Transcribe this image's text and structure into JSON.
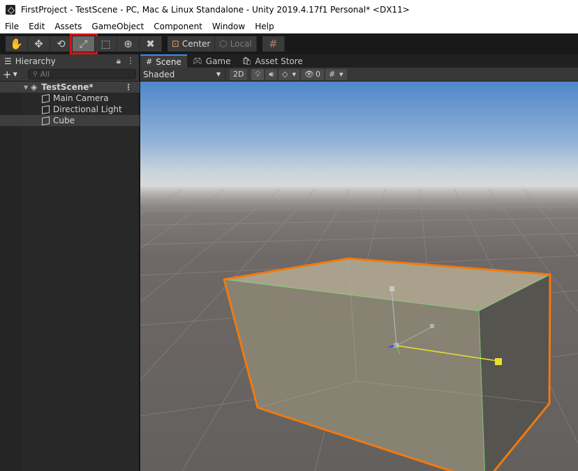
{
  "window": {
    "title": "FirstProject - TestScene - PC, Mac & Linux Standalone - Unity 2019.4.17f1 Personal* <DX11>"
  },
  "menu": [
    "File",
    "Edit",
    "Assets",
    "GameObject",
    "Component",
    "Window",
    "Help"
  ],
  "toolbar": {
    "tools": [
      {
        "name": "hand-tool",
        "icon": "hand-icon",
        "glyph": "✋"
      },
      {
        "name": "move-tool",
        "icon": "move-icon",
        "glyph": "✥"
      },
      {
        "name": "rotate-tool",
        "icon": "rotate-icon",
        "glyph": "⟲"
      },
      {
        "name": "scale-tool",
        "icon": "scale-icon",
        "glyph": "⤢"
      },
      {
        "name": "rect-tool",
        "icon": "rect-icon",
        "glyph": "⬚"
      },
      {
        "name": "transform-tool",
        "icon": "transform-icon",
        "glyph": "⊕"
      },
      {
        "name": "custom-tool",
        "icon": "tools-icon",
        "glyph": "✖"
      }
    ],
    "active_tool": "scale-tool",
    "highlighted_tool": "scale-tool",
    "pivot_mode": "Center",
    "pivot_rotation": "Local",
    "snap_icon": "grid-snap-icon"
  },
  "hierarchy": {
    "title": "Hierarchy",
    "add_label": "+",
    "search_placeholder": "All",
    "scene_name": "TestScene*",
    "items": [
      {
        "label": "Main Camera",
        "selected": false
      },
      {
        "label": "Directional Light",
        "selected": false
      },
      {
        "label": "Cube",
        "selected": true
      }
    ]
  },
  "scene_view": {
    "tabs": [
      {
        "label": "Scene",
        "icon": "grid-icon",
        "active": true
      },
      {
        "label": "Game",
        "icon": "gamepad-icon",
        "active": false
      },
      {
        "label": "Asset Store",
        "icon": "store-icon",
        "active": false
      }
    ],
    "draw_mode": "Shaded",
    "mode_2d": "2D",
    "hidden_count": "0",
    "colors": {
      "sky_top": "#4f86c8",
      "horizon": "#d4d6d8",
      "ground": "#6e6866",
      "selection_outline": "#f07a10",
      "cube_face_top": "#aaa18c",
      "cube_face_front": "#8a8474",
      "cube_face_side": "#56544e",
      "gizmo_x": "#e8e030",
      "gizmo_y": "#50d050",
      "gizmo_z": "#3050e0"
    }
  }
}
